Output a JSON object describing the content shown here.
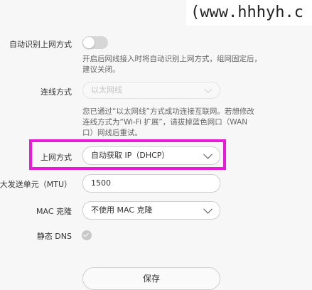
{
  "watermark": "(www.hhhyh.c",
  "auto_detect": {
    "label": "自动识别上网方式",
    "on": false,
    "hint_line1": "开启后网线接入时将自动识别上网方式，组网固定后，",
    "hint_line2": "建议关闭。"
  },
  "connection_type": {
    "label": "连线方式",
    "value": "以太网线",
    "disabled": true,
    "hint_line1": "您已通过“以太网线”方式成功连接互联网。若想修改",
    "hint_line2": "连线方式为“Wi-Fi 扩展”，请拔掉蓝色网口（WAN",
    "hint_line3": "口）网线后重试。"
  },
  "internet_mode": {
    "label": "上网方式",
    "value": "自动获取 IP（DHCP）",
    "highlight_color": "#e81bd9"
  },
  "mtu": {
    "label": "最大发送单元（MTU）",
    "value": "1500"
  },
  "mac_clone": {
    "label": "MAC 克隆",
    "value": "不使用 MAC 克隆"
  },
  "static_dns": {
    "label": "静态 DNS",
    "checked": true
  },
  "save_button": "保存"
}
